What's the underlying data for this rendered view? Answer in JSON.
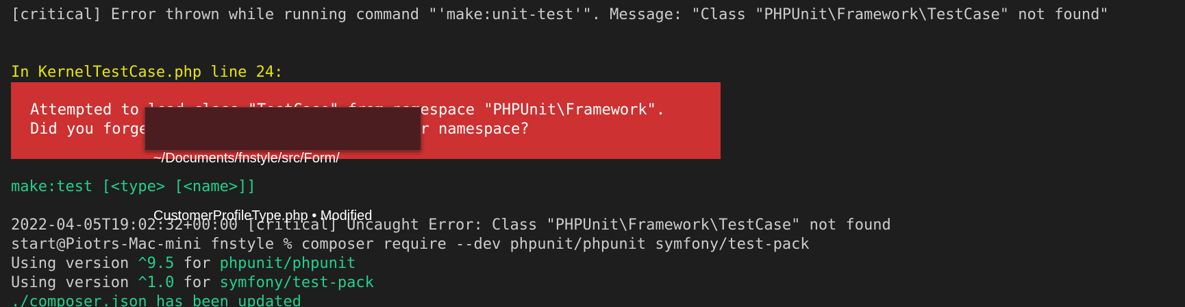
{
  "terminal": {
    "critical_line": "[critical] Error thrown while running command \"'make:unit-test'\". Message: \"Class \"PHPUnit\\Framework\\TestCase\" not found\"",
    "file_line": "In KernelTestCase.php line 24:",
    "error_box": {
      "line1": "Attempted to load class \"TestCase\" from namespace \"PHPUnit\\Framework\".",
      "line2": "Did you forget a \"use\" statement for another namespace?"
    },
    "usage_line": "make:test [<type> [<name>]]",
    "log_line": "2022-04-05T19:02:32+00:00 [critical] Uncaught Error: Class \"PHPUnit\\Framework\\TestCase\" not found",
    "prompt_line": "start@Piotrs-Mac-mini fnstyle % composer require --dev phpunit/phpunit symfony/test-pack",
    "version_lines": [
      {
        "prefix": "Using version ",
        "version": "^9.5",
        "middle": " for ",
        "package": "phpunit/phpunit"
      },
      {
        "prefix": "Using version ",
        "version": "^1.0",
        "middle": " for ",
        "package": "symfony/test-pack"
      }
    ],
    "updated_line": "./composer.json has been updated"
  },
  "tooltip": {
    "path_line": "~/Documents/fnstyle/src/Form/",
    "file_line": "CustomerProfileType.php • Modified"
  },
  "colors": {
    "background": "#1e1e1e",
    "foreground": "#cccccc",
    "yellow": "#e5e510",
    "green": "#23d18b",
    "error_background": "#cd3131",
    "tooltip_background": "#4b1d21"
  }
}
